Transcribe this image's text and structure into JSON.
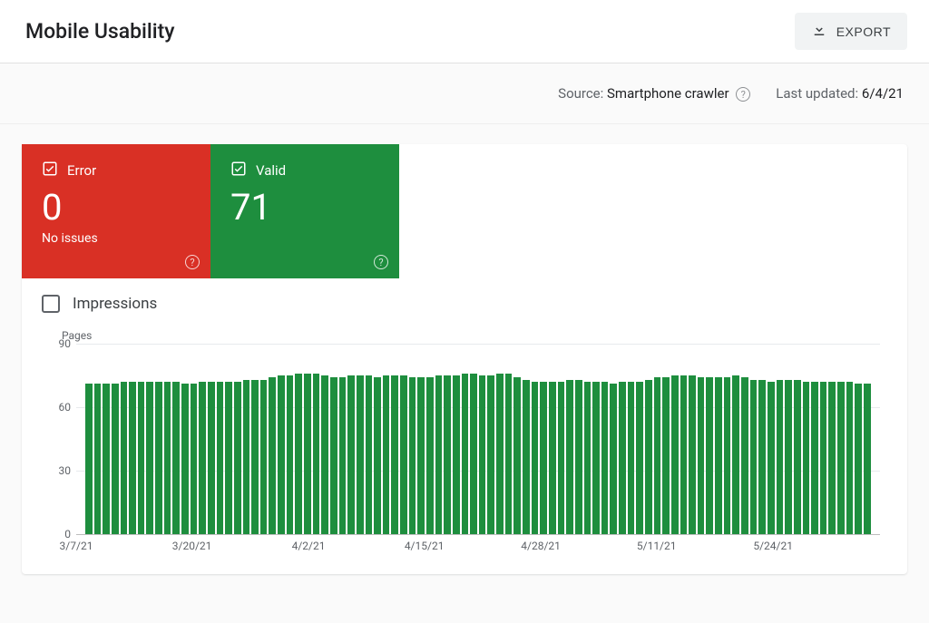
{
  "header": {
    "title": "Mobile Usability",
    "export_label": "EXPORT"
  },
  "meta": {
    "source_label": "Source:",
    "source_value": "Smartphone crawler",
    "updated_label": "Last updated:",
    "updated_value": "6/4/21"
  },
  "tiles": {
    "error": {
      "label": "Error",
      "count": "0",
      "sub": "No issues"
    },
    "valid": {
      "label": "Valid",
      "count": "71"
    }
  },
  "impressions": {
    "label": "Impressions",
    "checked": false
  },
  "chart_data": {
    "type": "bar",
    "title": "Pages",
    "xlabel": "",
    "ylabel": "Pages",
    "ylim": [
      0,
      90
    ],
    "y_ticks": [
      0,
      30,
      60,
      90
    ],
    "x_tick_labels": [
      "3/7/21",
      "3/20/21",
      "4/2/21",
      "4/15/21",
      "4/28/21",
      "5/11/21",
      "5/24/21"
    ],
    "x_tick_positions": [
      0,
      14.4,
      28.9,
      43.3,
      57.8,
      72.2,
      86.7
    ],
    "categories": [
      "3/7/21",
      "3/8/21",
      "3/9/21",
      "3/10/21",
      "3/11/21",
      "3/12/21",
      "3/13/21",
      "3/14/21",
      "3/15/21",
      "3/16/21",
      "3/17/21",
      "3/18/21",
      "3/19/21",
      "3/20/21",
      "3/21/21",
      "3/22/21",
      "3/23/21",
      "3/24/21",
      "3/25/21",
      "3/26/21",
      "3/27/21",
      "3/28/21",
      "3/29/21",
      "3/30/21",
      "3/31/21",
      "4/1/21",
      "4/2/21",
      "4/3/21",
      "4/4/21",
      "4/5/21",
      "4/6/21",
      "4/7/21",
      "4/8/21",
      "4/9/21",
      "4/10/21",
      "4/11/21",
      "4/12/21",
      "4/13/21",
      "4/14/21",
      "4/15/21",
      "4/16/21",
      "4/17/21",
      "4/18/21",
      "4/19/21",
      "4/20/21",
      "4/21/21",
      "4/22/21",
      "4/23/21",
      "4/24/21",
      "4/25/21",
      "4/26/21",
      "4/27/21",
      "4/28/21",
      "4/29/21",
      "4/30/21",
      "5/1/21",
      "5/2/21",
      "5/3/21",
      "5/4/21",
      "5/5/21",
      "5/6/21",
      "5/7/21",
      "5/8/21",
      "5/9/21",
      "5/10/21",
      "5/11/21",
      "5/12/21",
      "5/13/21",
      "5/14/21",
      "5/15/21",
      "5/16/21",
      "5/17/21",
      "5/18/21",
      "5/19/21",
      "5/20/21",
      "5/21/21",
      "5/22/21",
      "5/23/21",
      "5/24/21",
      "5/25/21",
      "5/26/21",
      "5/27/21",
      "5/28/21",
      "5/29/21",
      "5/30/21",
      "5/31/21",
      "6/1/21",
      "6/2/21",
      "6/3/21",
      "6/4/21"
    ],
    "values": [
      71,
      71,
      71,
      71,
      72,
      72,
      72,
      72,
      72,
      72,
      72,
      71,
      71,
      72,
      72,
      72,
      72,
      72,
      73,
      73,
      73,
      74,
      75,
      75,
      76,
      76,
      76,
      75,
      74,
      74,
      75,
      75,
      75,
      74,
      75,
      75,
      75,
      74,
      74,
      74,
      75,
      75,
      75,
      76,
      76,
      75,
      75,
      76,
      76,
      74,
      73,
      72,
      72,
      72,
      72,
      73,
      73,
      72,
      72,
      72,
      71,
      72,
      72,
      72,
      73,
      74,
      74,
      75,
      75,
      75,
      74,
      74,
      74,
      74,
      75,
      74,
      73,
      73,
      72,
      73,
      73,
      73,
      72,
      72,
      72,
      72,
      72,
      72,
      71,
      71
    ]
  }
}
